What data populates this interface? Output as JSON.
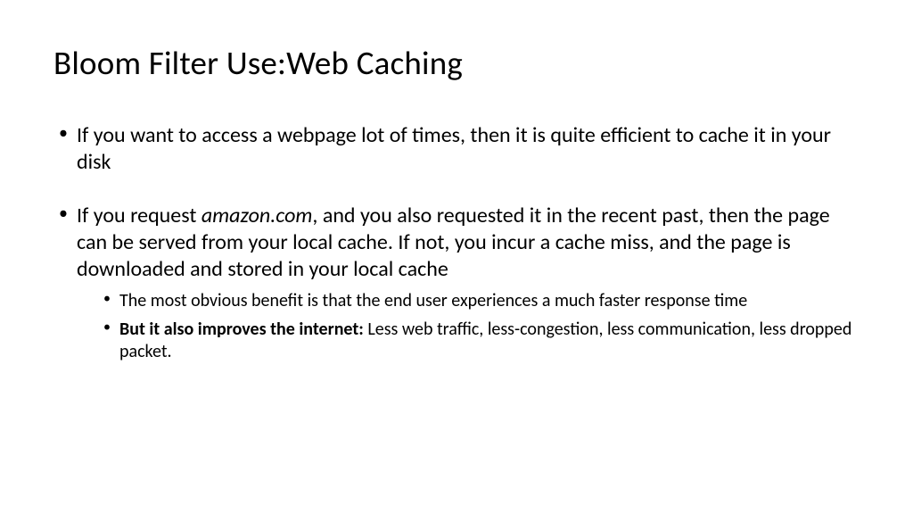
{
  "title": "Bloom Filter Use:Web Caching",
  "bullets": {
    "b1": "If you want to access a webpage lot of times, then it is quite efficient to cache it in your disk",
    "b2_pre": "If you request ",
    "b2_em": "amazon.com",
    "b2_post": ", and you also requested it in the recent past, then the page can be served from your local cache. If not, you incur a cache miss, and the page is downloaded and stored in your local cache",
    "sub1": "The most obvious benefit is that the end user experiences a much faster response time",
    "sub2_bold": "But it also improves the internet: ",
    "sub2_rest": "Less web traffic, less-congestion, less communication, less dropped packet."
  }
}
